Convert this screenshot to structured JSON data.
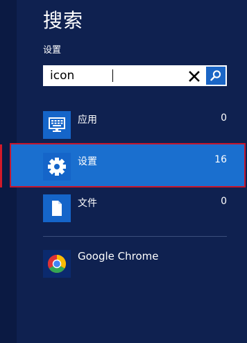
{
  "search_pane": {
    "title": "搜索",
    "scope": "设置",
    "query": "icon"
  },
  "categories": [
    {
      "label": "应用",
      "count": "0",
      "icon": "display-keyboard-icon"
    },
    {
      "label": "设置",
      "count": "16",
      "icon": "gear-icon",
      "selected": true
    },
    {
      "label": "文件",
      "count": "0",
      "icon": "document-icon"
    }
  ],
  "apps": [
    {
      "label": "Google Chrome",
      "icon": "chrome-icon"
    }
  ],
  "colors": {
    "background": "#0f2150",
    "tile": "#1565c9",
    "selected": "#1a6fcf",
    "selection_border": "#c5162c"
  }
}
